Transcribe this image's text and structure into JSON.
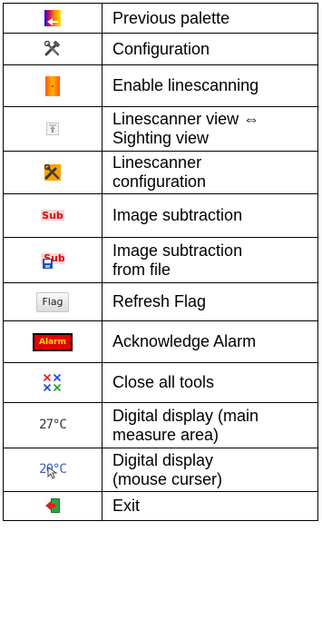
{
  "rows": [
    {
      "icon": "previous-palette-icon",
      "label": "Previous palette"
    },
    {
      "icon": "configuration-icon",
      "label": "Configuration"
    },
    {
      "icon": "enable-linescanning-icon",
      "label": "Enable linescanning"
    },
    {
      "icon": "linescanner-view-icon",
      "label": "Linescanner view ⇔\nSighting view"
    },
    {
      "icon": "linescanner-configuration-icon",
      "label": "Linescanner\nconfiguration"
    },
    {
      "icon": "image-subtraction-icon",
      "label": "Image subtraction",
      "icon_text": "Sub"
    },
    {
      "icon": "image-subtraction-file-icon",
      "label": "Image subtraction\nfrom file",
      "icon_text": "Sub"
    },
    {
      "icon": "refresh-flag-icon",
      "label": "Refresh Flag",
      "icon_text": "Flag"
    },
    {
      "icon": "acknowledge-alarm-icon",
      "label": "Acknowledge Alarm",
      "icon_text": "Alarm"
    },
    {
      "icon": "close-all-tools-icon",
      "label": "Close all tools"
    },
    {
      "icon": "digital-display-icon",
      "label": "Digital display (main\nmeasure area)",
      "icon_text": "27°C"
    },
    {
      "icon": "digital-display-mouse-icon",
      "label": "Digital display\n(mouse curser)",
      "icon_text": "20°C"
    },
    {
      "icon": "exit-icon",
      "label": "Exit"
    }
  ]
}
